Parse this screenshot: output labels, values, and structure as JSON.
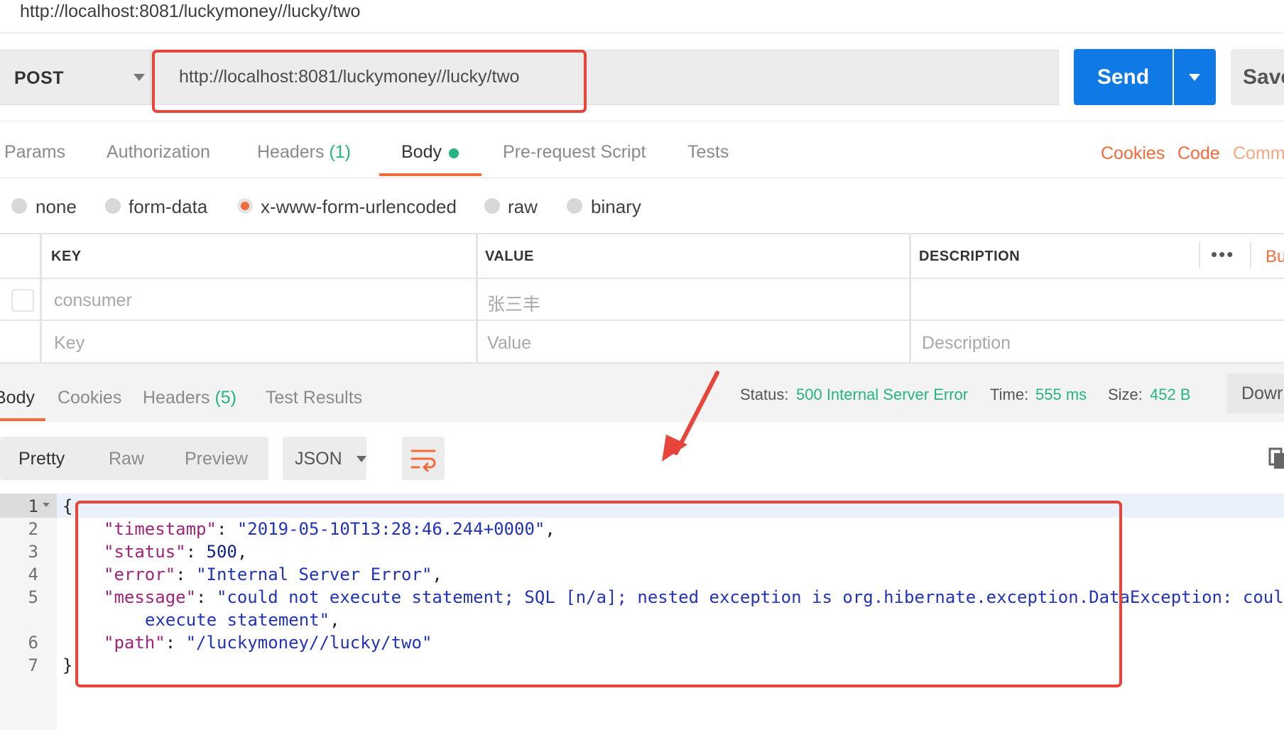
{
  "window": {
    "title": "http://localhost:8081/luckymoney//lucky/two"
  },
  "request": {
    "method": "POST",
    "url": "http://localhost:8081/luckymoney//lucky/two",
    "send_label": "Send",
    "save_label": "Save"
  },
  "request_tabs": {
    "params": "Params",
    "authorization": "Authorization",
    "headers": "Headers",
    "headers_count": "(1)",
    "body": "Body",
    "pre_request": "Pre-request Script",
    "tests": "Tests",
    "cookies": "Cookies",
    "code": "Code",
    "comments": "Comm"
  },
  "body_types": {
    "selected": "x-www-form-urlencoded",
    "options": [
      "none",
      "form-data",
      "x-www-form-urlencoded",
      "raw",
      "binary"
    ]
  },
  "params_table": {
    "headers": {
      "key": "KEY",
      "value": "VALUE",
      "description": "DESCRIPTION"
    },
    "more_label": "•••",
    "bulk_label": "Bu",
    "rows": [
      {
        "key": "consumer",
        "value": "张三丰",
        "description": ""
      }
    ],
    "placeholder": {
      "key": "Key",
      "value": "Value",
      "description": "Description"
    }
  },
  "response_tabs": {
    "body": "Body",
    "cookies": "Cookies",
    "headers": "Headers",
    "headers_count": "(5)",
    "test_results": "Test Results"
  },
  "response_status": {
    "status_label": "Status:",
    "status_value": "500 Internal Server Error",
    "time_label": "Time:",
    "time_value": "555 ms",
    "size_label": "Size:",
    "size_value": "452 B",
    "download_label": "Dowr"
  },
  "viewer": {
    "modes": {
      "pretty": "Pretty",
      "raw": "Raw",
      "preview": "Preview"
    },
    "format": "JSON"
  },
  "response_body": {
    "line_numbers": [
      "1",
      "2",
      "3",
      "4",
      "5",
      "6",
      "7"
    ],
    "open_brace": "{",
    "close_brace": "}",
    "timestamp_key": "\"timestamp\"",
    "timestamp_value": "\"2019-05-10T13:28:46.244+0000\"",
    "status_key": "\"status\"",
    "status_value": "500",
    "error_key": "\"error\"",
    "error_value": "\"Internal Server Error\"",
    "message_key": "\"message\"",
    "message_value_line1": "\"could not execute statement; SQL [n/a]; nested exception is org.hibernate.exception.DataException: could",
    "message_value_line2": "execute statement\"",
    "path_key": "\"path\"",
    "path_value": "\"/luckymoney//lucky/two\""
  },
  "colors": {
    "accent": "#f26b3a",
    "send_blue": "#0f7ae5",
    "success_green": "#26b47f",
    "annotation_red": "#e8443a"
  }
}
